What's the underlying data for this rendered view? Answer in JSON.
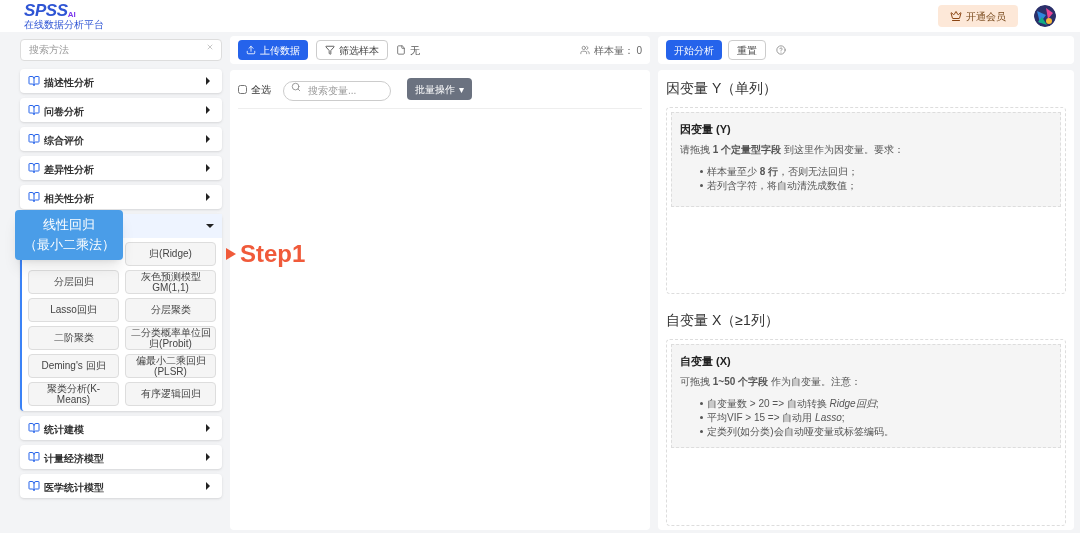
{
  "header": {
    "logo": "SPSS",
    "logo_suffix": "AI",
    "tagline": "在线数据分析平台",
    "vip_button": "开通会员"
  },
  "sidebar": {
    "search": {
      "placeholder": "搜索方法"
    },
    "categories": [
      {
        "label": "描述性分析",
        "expanded": false
      },
      {
        "label": "问卷分析",
        "expanded": false
      },
      {
        "label": "综合评价",
        "expanded": false
      },
      {
        "label": "差异性分析",
        "expanded": false
      },
      {
        "label": "相关性分析",
        "expanded": false
      },
      {
        "expanded": true,
        "first_slot_covered": true,
        "methods": [
          "归(Ridge)",
          "分层回归",
          "灰色预测模型GM(1,1)",
          "Lasso回归",
          "分层聚类",
          "二阶聚类",
          "二分类概率单位回归(Probit)",
          "Deming's 回归",
          "偏最小二乘回归(PLSR)",
          "聚类分析(K-Means)",
          "有序逻辑回归"
        ]
      },
      {
        "label": "统计建模",
        "expanded": false
      },
      {
        "label": "计量经济模型",
        "expanded": false
      },
      {
        "label": "医学统计模型",
        "expanded": false
      }
    ]
  },
  "callout": {
    "lines": [
      "线性回归",
      "（最小二乘法）"
    ],
    "step": "Step1"
  },
  "data_panel": {
    "upload_button": "上传数据",
    "filter_button": "筛选样本",
    "file_name": "无",
    "sample_size": "样本量： 0",
    "select_all": {
      "label": "全选",
      "checked": false
    },
    "variable_search": {
      "placeholder": "搜索变量..."
    },
    "batch_button": "批量操作",
    "batch_caret": "▾"
  },
  "analysis_panel": {
    "start_button": "开始分析",
    "reset_button": "重置",
    "sections": [
      {
        "heading": "因变量 Y（单列）",
        "box_title": "因变量 (Y)",
        "intro": "请拖拽 **1 个定量型字段** 到这里作为因变量。要求：",
        "bullets": [
          "样本量至少 **8 行**，否则无法回归；",
          "若列含字符，将自动清洗成数值；"
        ]
      },
      {
        "heading": "自变量 X（≥1列）",
        "box_title": "自变量 (X)",
        "intro": "可拖拽 **1~50 个字段** 作为自变量。注意：",
        "bullets": [
          "自变量数 > 20 => 自动转换 *Ridge回归*;",
          "平均VIF > 15 => 自动用 *Lasso*;",
          "定类列(如分类)会自动哑变量或标签编码。"
        ]
      }
    ]
  }
}
